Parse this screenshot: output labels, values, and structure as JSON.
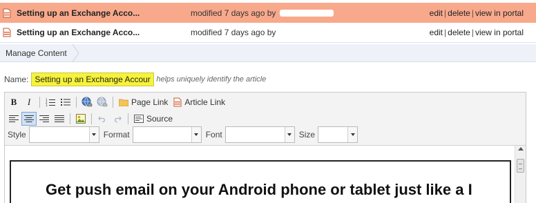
{
  "content_rows": [
    {
      "title": "Setting up an Exchange Acco...",
      "modified": "modified 7 days ago by",
      "actions": {
        "edit": "edit",
        "delete": "delete",
        "view": "view in portal"
      }
    },
    {
      "title": "Setting up an Exchange Acco...",
      "modified": "modified 7 days ago by",
      "actions": {
        "edit": "edit",
        "delete": "delete",
        "view": "view in portal"
      }
    }
  ],
  "breadcrumb": {
    "manage": "Manage Content"
  },
  "name_field": {
    "label": "Name:",
    "value": "Setting up an Exchange Accour",
    "hint": "helps uniquely identify the article"
  },
  "toolbar": {
    "bold": "B",
    "italic": "I",
    "page_link": "Page Link",
    "article_link": "Article Link",
    "source": "Source",
    "style_label": "Style",
    "format_label": "Format",
    "font_label": "Font",
    "size_label": "Size"
  },
  "editor": {
    "heading": "Get push email on your Android phone or tablet just like a I"
  },
  "colors": {
    "highlight_row": "#f8a98b",
    "name_highlight": "#f6f33a",
    "accent_blue": "#7aa3d4"
  },
  "icons": [
    "document-icon",
    "bold-icon",
    "italic-icon",
    "ordered-list-icon",
    "unordered-list-icon",
    "globe-link-icon",
    "unlink-icon",
    "page-link-icon",
    "article-link-icon",
    "align-left-icon",
    "align-center-icon",
    "align-right-icon",
    "justify-icon",
    "image-icon",
    "undo-icon",
    "redo-icon",
    "source-icon",
    "dropdown-arrow-icon",
    "scroll-up-icon"
  ]
}
